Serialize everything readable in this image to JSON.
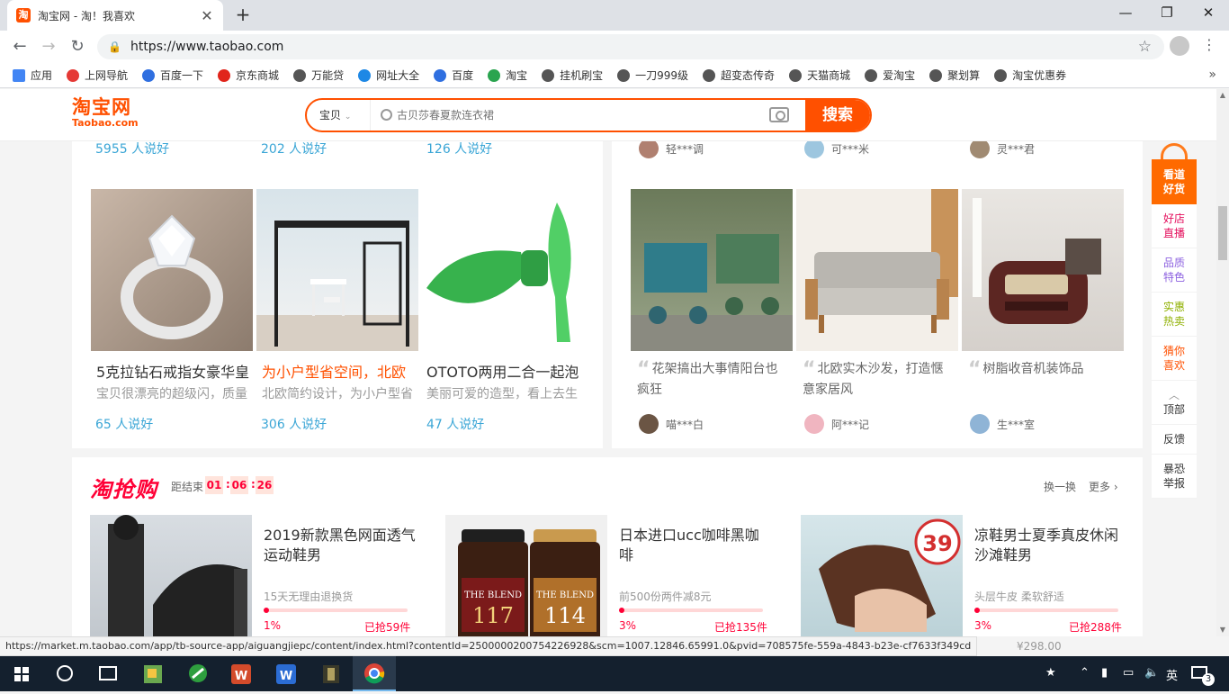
{
  "browser": {
    "tab_title": "淘宝网 - 淘！我喜欢",
    "tab_favicon": "淘",
    "url": "https://www.taobao.com",
    "new_tab_glyph": "+",
    "close_glyph": "✕"
  },
  "bookmarks": [
    {
      "label": "应用",
      "color": "#4285f4"
    },
    {
      "label": "上网导航",
      "color": "#e53935"
    },
    {
      "label": "百度一下",
      "color": "#2f6fe0"
    },
    {
      "label": "京东商城",
      "color": "#e1251b"
    },
    {
      "label": "万能贷",
      "color": "#555555"
    },
    {
      "label": "网址大全",
      "color": "#1e88e5"
    },
    {
      "label": "百度",
      "color": "#2f6fe0"
    },
    {
      "label": "淘宝",
      "color": "#2aa44f"
    },
    {
      "label": "挂机刷宝",
      "color": "#555555"
    },
    {
      "label": "一刀999级",
      "color": "#555555"
    },
    {
      "label": "超变态传奇",
      "color": "#555555"
    },
    {
      "label": "天猫商城",
      "color": "#555555"
    },
    {
      "label": "爱淘宝",
      "color": "#555555"
    },
    {
      "label": "聚划算",
      "color": "#555555"
    },
    {
      "label": "淘宝优惠券",
      "color": "#555555"
    }
  ],
  "header": {
    "logo_cn": "淘宝网",
    "logo_en": "Taobao.com",
    "search_category": "宝贝",
    "search_placeholder": "古贝莎春夏款连衣裙",
    "search_button": "搜索"
  },
  "left_card": {
    "top_likes": [
      "5955 人说好",
      "202 人说好",
      "126 人说好"
    ],
    "items": [
      {
        "title": "5克拉钻石戒指女豪华皇",
        "desc": "宝贝很漂亮的超级闪，质量",
        "likes": "65 人说好",
        "red": false
      },
      {
        "title": "为小户型省空间，北欧",
        "desc": "北欧简约设计，为小户型省",
        "likes": "306 人说好",
        "red": true
      },
      {
        "title": "OTOTO两用二合一起泡",
        "desc": "美丽可爱的造型，看上去生",
        "likes": "47 人说好",
        "red": false
      }
    ]
  },
  "right_card": {
    "top_users": [
      "轻***调",
      "可***米",
      "灵***君"
    ],
    "items": [
      {
        "quote": "花架搞出大事情阳台也疯狂",
        "user": "喵***白"
      },
      {
        "quote": "北欧实木沙发，打造惬意家居风",
        "user": "阿***记"
      },
      {
        "quote": "树脂收音机装饰品",
        "user": "生***室"
      }
    ]
  },
  "side_tools": {
    "top": "看道好货",
    "items": [
      {
        "label": "好店直播",
        "color": "#e40e5c"
      },
      {
        "label": "品质特色",
        "color": "#8e63e0"
      },
      {
        "label": "实惠热卖",
        "color": "#8fb000"
      },
      {
        "label": "猜你喜欢",
        "color": "#ff5000"
      },
      {
        "label": "顶部",
        "color": "#333333"
      },
      {
        "label": "反馈",
        "color": "#333333"
      },
      {
        "label": "暴恐举报",
        "color": "#333333"
      }
    ]
  },
  "flash_sale": {
    "logo": "淘抢购",
    "ends_label": "距结束",
    "countdown": [
      "01",
      "06",
      "26"
    ],
    "refresh": "换一换",
    "more": "更多",
    "items": [
      {
        "title": "2019新款黑色网面透气运动鞋男",
        "sub": "15天无理由退换货",
        "pct": "1%",
        "sold": "已抢59件",
        "progress": 0.01
      },
      {
        "title": "日本进口ucc咖啡黑咖啡",
        "sub": "前500份两件减8元",
        "pct": "3%",
        "sold": "已抢135件",
        "progress": 0.03
      },
      {
        "title": "凉鞋男士夏季真皮休闲沙滩鞋男",
        "sub": "头层牛皮 柔软舒适",
        "pct": "3%",
        "sold": "已抢288件",
        "progress": 0.03
      }
    ],
    "coffee_labels": [
      "THE BLEND",
      "117",
      "THE BLEND",
      "114"
    ],
    "sandal_badge": "39"
  },
  "status": {
    "link": "https://market.m.taobao.com/app/tb-source-app/aiguangjiepc/content/index.html?contentId=2500000200754226928&scm=1007.12846.65991.0&pvid=708575fe-559a-4843-b23e-cf7633f349cd",
    "price": "¥298.00"
  },
  "taskbar": {
    "ime": "英",
    "notifications": "3"
  }
}
